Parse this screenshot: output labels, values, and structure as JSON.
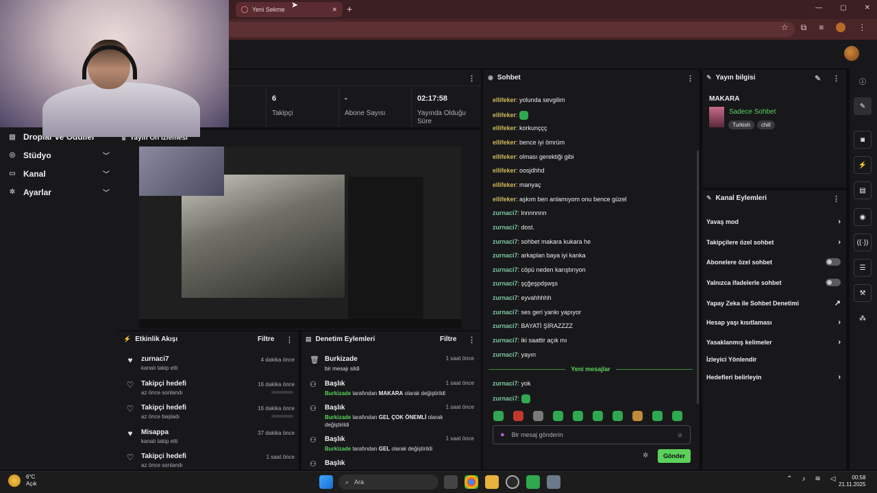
{
  "browser": {
    "tab_title": "Yeni Sekme",
    "new_tab": "+",
    "window_controls": [
      "—",
      "▢",
      "✕"
    ]
  },
  "sidebar": {
    "items": [
      {
        "label": "Droplar ve Ödüller",
        "icon": "gift-icon",
        "chevron": ""
      },
      {
        "label": "Stüdyo",
        "icon": "studio-icon",
        "chevron": "⌄"
      },
      {
        "label": "Kanal",
        "icon": "channel-icon",
        "chevron": "⌄"
      },
      {
        "label": "Ayarlar",
        "icon": "gear-icon",
        "chevron": "⌄"
      }
    ]
  },
  "stats": {
    "items": [
      {
        "value": "6",
        "label": "Takipçi"
      },
      {
        "value": "-",
        "label": "Abone Sayısı"
      },
      {
        "value": "02:17:58",
        "label": "Yayında Olduğu Süre"
      }
    ]
  },
  "preview": {
    "title": "Yayın Ön İzlemesi"
  },
  "activity": {
    "title": "Etkinlik Akışı",
    "filter": "Filtre",
    "events": [
      {
        "name": "zurnaci7",
        "desc": "kanalı takip etti",
        "time": "4 dakika önce",
        "icon": "heart-filled-icon",
        "bar": false
      },
      {
        "name": "Takipçi hedefi",
        "desc": "az önce sonlandı",
        "time": "16 dakika önce",
        "icon": "heart-outline-icon",
        "bar": true
      },
      {
        "name": "Takipçi hedefi",
        "desc": "az önce başladı",
        "time": "16 dakika önce",
        "icon": "heart-outline-icon",
        "bar": true
      },
      {
        "name": "Misappa",
        "desc": "kanalı takip etti",
        "time": "37 dakika önce",
        "icon": "heart-filled-icon",
        "bar": false
      },
      {
        "name": "Takipçi hedefi",
        "desc": "az önce sonlandı",
        "time": "1 saat önce",
        "icon": "heart-outline-icon",
        "bar": false
      }
    ]
  },
  "moderation": {
    "title": "Denetim Eylemleri",
    "filter": "Filtre",
    "events": [
      {
        "name": "Burkizade",
        "pre": "",
        "mid": "bir mesajı sildi",
        "val": "",
        "post": "",
        "time": "1 saat önce",
        "icon": "trash-icon"
      },
      {
        "name": "Başlık",
        "pre": "Burkizade",
        "mid": " tarafından ",
        "val": "MAKARA",
        "post": " olarak değiştirildi",
        "time": "1 saat önce",
        "icon": "edit-user-icon"
      },
      {
        "name": "Başlık",
        "pre": "Burkizade",
        "mid": " tarafından ",
        "val": "GEL ÇOK ÖNEMLİ",
        "post": " olarak değiştirildi",
        "time": "1 saat önce",
        "icon": "edit-user-icon"
      },
      {
        "name": "Başlık",
        "pre": "Burkizade",
        "mid": " tarafından ",
        "val": "GEL",
        "post": " olarak değiştirildi",
        "time": "1 saat önce",
        "icon": "edit-user-icon"
      },
      {
        "name": "Başlık",
        "pre": "",
        "mid": "",
        "val": "",
        "post": "",
        "time": "",
        "icon": "edit-user-icon"
      }
    ]
  },
  "chat": {
    "title": "Sohbet",
    "messages": [
      {
        "user": "ellifeker",
        "text": "yolunda sevgilim",
        "emote": false
      },
      {
        "user": "ellifeker",
        "text": "",
        "emote": true
      },
      {
        "user": "ellifeker",
        "text": "korkunççç",
        "emote": false
      },
      {
        "user": "ellifeker",
        "text": "bence iyi ömrüm",
        "emote": false
      },
      {
        "user": "ellifeker",
        "text": "olması gerektiği gibi",
        "emote": false
      },
      {
        "user": "ellifeker",
        "text": "oosjdhhd",
        "emote": false
      },
      {
        "user": "ellifeker",
        "text": "manyaç",
        "emote": false
      },
      {
        "user": "ellifeker",
        "text": "aşkım ben anlamıyom onu bence güzel",
        "emote": false
      },
      {
        "user": "zurnaci7",
        "text": "lnnnnnnn",
        "emote": false
      },
      {
        "user": "zurnaci7",
        "text": "dost.",
        "emote": false
      },
      {
        "user": "zurnaci7",
        "text": "sohbet makara kukara he",
        "emote": false
      },
      {
        "user": "zurnaci7",
        "text": "arkaplan baya iyi kanka",
        "emote": false
      },
      {
        "user": "zurnaci7",
        "text": "cöpü neden karıştırıyon",
        "emote": false
      },
      {
        "user": "zurnaci7",
        "text": "şçğeşpdşwşs",
        "emote": false
      },
      {
        "user": "zurnaci7",
        "text": "eyvahhhhh",
        "emote": false
      },
      {
        "user": "zurnaci7",
        "text": "ses geri yankı yapıyor",
        "emote": false
      },
      {
        "user": "zurnaci7",
        "text": "BAYATİ ŞİRAZZZZ",
        "emote": false
      },
      {
        "user": "zurnaci7",
        "text": "iki saattir açık mı",
        "emote": false
      },
      {
        "user": "zurnaci7",
        "text": "yayın",
        "emote": false
      }
    ],
    "new_messages_label": "Yeni mesajlar",
    "after": [
      {
        "user": "zurnaci7",
        "text": "yok",
        "emote": false
      },
      {
        "user": "zurnaci7",
        "text": "",
        "emote": true
      }
    ],
    "input_placeholder": "Bir mesaj gönderin",
    "send_label": "Gönder",
    "emote_count": 10
  },
  "stream_info": {
    "title": "Yayın bilgisi",
    "stream_title": "MAKARA",
    "category": "Sadece Sohbet",
    "tags": [
      "Turkish",
      "chill"
    ]
  },
  "channel_actions": {
    "title": "Kanal Eylemleri",
    "items": [
      {
        "label": "Yavaş mod",
        "control": "chevron"
      },
      {
        "label": "Takipçilere özel sohbet",
        "control": "chevron"
      },
      {
        "label": "Abonelere özel sohbet",
        "control": "toggle"
      },
      {
        "label": "Yalnızca ifadelerle sohbet",
        "control": "toggle"
      },
      {
        "label": "Yapay Zeka ile Sohbet Denetimi",
        "control": "external"
      },
      {
        "label": "Hesap yaşı kısıtlaması",
        "control": "chevron"
      },
      {
        "label": "Yasaklanmış kelimeler",
        "control": "chevron"
      },
      {
        "label": "İzleyici Yönlendir",
        "control": "none"
      },
      {
        "label": "Hedefleri belirleyin",
        "control": "chevron"
      }
    ]
  },
  "taskbar": {
    "temperature": "6°C",
    "weather": "Açık",
    "search_placeholder": "Ara",
    "time": "00:58",
    "date": "21.11.2025"
  },
  "colors": {
    "accent": "#5bd15b",
    "panel": "#18181b",
    "bg": "#0e0e10",
    "chrome": "#3b1f22"
  }
}
